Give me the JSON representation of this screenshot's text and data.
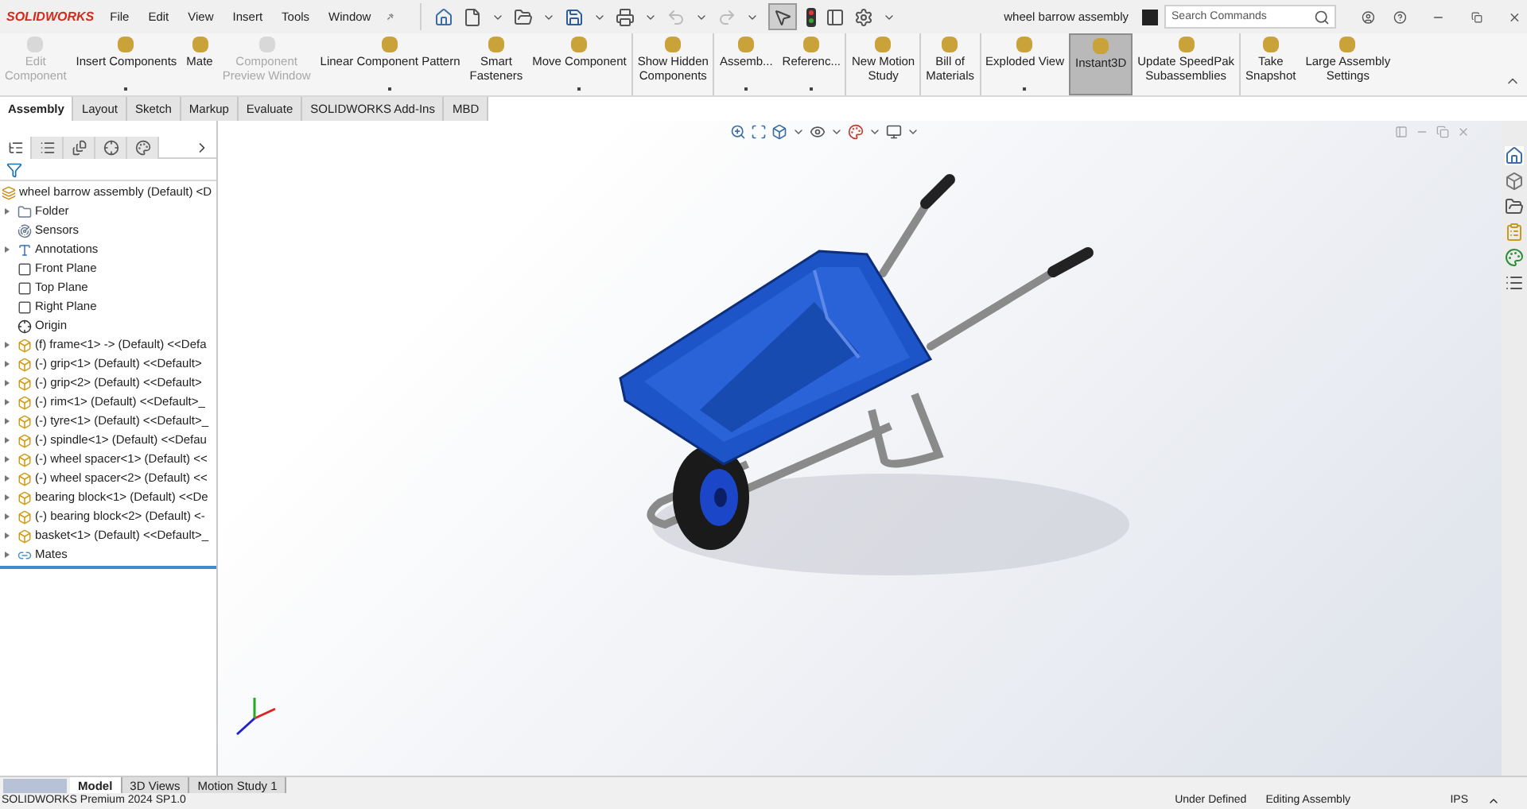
{
  "app": {
    "logo": "SOLIDWORKS",
    "title": "wheel barrow assembly"
  },
  "menu": [
    "File",
    "Edit",
    "View",
    "Insert",
    "Tools",
    "Window"
  ],
  "select_tool": {
    "selected": true
  },
  "search": {
    "placeholder": "Search Commands"
  },
  "commands": [
    {
      "label": "Edit\nComponent",
      "disabled": true,
      "selected": false,
      "dropdown": false,
      "divider_after": false
    },
    {
      "label": "Insert Components",
      "disabled": false,
      "selected": false,
      "dropdown": true,
      "divider_after": false
    },
    {
      "label": "Mate",
      "disabled": false,
      "selected": false,
      "dropdown": false,
      "divider_after": false
    },
    {
      "label": "Component\nPreview Window",
      "disabled": true,
      "selected": false,
      "dropdown": false,
      "divider_after": false
    },
    {
      "label": "Linear Component Pattern",
      "disabled": false,
      "selected": false,
      "dropdown": true,
      "divider_after": false
    },
    {
      "label": "Smart\nFasteners",
      "disabled": false,
      "selected": false,
      "dropdown": false,
      "divider_after": false
    },
    {
      "label": "Move Component",
      "disabled": false,
      "selected": false,
      "dropdown": true,
      "divider_after": true
    },
    {
      "label": "Show Hidden\nComponents",
      "disabled": false,
      "selected": false,
      "dropdown": false,
      "divider_after": true
    },
    {
      "label": "Assemb...",
      "disabled": false,
      "selected": false,
      "dropdown": true,
      "divider_after": false
    },
    {
      "label": "Referenc...",
      "disabled": false,
      "selected": false,
      "dropdown": true,
      "divider_after": true
    },
    {
      "label": "New Motion\nStudy",
      "disabled": false,
      "selected": false,
      "dropdown": false,
      "divider_after": true
    },
    {
      "label": "Bill of\nMaterials",
      "disabled": false,
      "selected": false,
      "dropdown": false,
      "divider_after": true
    },
    {
      "label": "Exploded View",
      "disabled": false,
      "selected": false,
      "dropdown": true,
      "divider_after": false
    },
    {
      "label": "Instant3D",
      "disabled": false,
      "selected": true,
      "dropdown": false,
      "divider_after": false
    },
    {
      "label": "Update SpeedPak\nSubassemblies",
      "disabled": false,
      "selected": false,
      "dropdown": false,
      "divider_after": true
    },
    {
      "label": "Take\nSnapshot",
      "disabled": false,
      "selected": false,
      "dropdown": false,
      "divider_after": false
    },
    {
      "label": "Large Assembly\nSettings",
      "disabled": false,
      "selected": false,
      "dropdown": false,
      "divider_after": false
    }
  ],
  "tabs": [
    {
      "label": "Assembly",
      "selected": true
    },
    {
      "label": "Layout",
      "selected": false
    },
    {
      "label": "Sketch",
      "selected": false
    },
    {
      "label": "Markup",
      "selected": false
    },
    {
      "label": "Evaluate",
      "selected": false
    },
    {
      "label": "SOLIDWORKS Add-Ins",
      "selected": false
    },
    {
      "label": "MBD",
      "selected": false
    }
  ],
  "manager_tabs": [
    {
      "kind": "tree",
      "selected": true
    },
    {
      "kind": "properties",
      "selected": false
    },
    {
      "kind": "config",
      "selected": false
    },
    {
      "kind": "dimxpert",
      "selected": false
    },
    {
      "kind": "display",
      "selected": false
    }
  ],
  "tree": {
    "label": "wheel barrow assembly (Default) <D",
    "kind": "assembly",
    "children": [
      {
        "label": "Folder",
        "kind": "folder",
        "has_children": true
      },
      {
        "label": "Sensors",
        "kind": "sensor",
        "has_children": false
      },
      {
        "label": "Annotations",
        "kind": "annotation",
        "has_children": true
      },
      {
        "label": "Front Plane",
        "kind": "plane",
        "has_children": false
      },
      {
        "label": "Top Plane",
        "kind": "plane",
        "has_children": false
      },
      {
        "label": "Right Plane",
        "kind": "plane",
        "has_children": false
      },
      {
        "label": "Origin",
        "kind": "origin",
        "has_children": false
      },
      {
        "label": "(f) frame<1> -> (Default) <<Defa",
        "kind": "part",
        "has_children": true
      },
      {
        "label": "(-) grip<1> (Default) <<Default>",
        "kind": "part",
        "has_children": true
      },
      {
        "label": "(-) grip<2> (Default) <<Default>",
        "kind": "part",
        "has_children": true
      },
      {
        "label": "(-) rim<1> (Default) <<Default>_",
        "kind": "part",
        "has_children": true
      },
      {
        "label": "(-) tyre<1> (Default) <<Default>_",
        "kind": "part",
        "has_children": true
      },
      {
        "label": "(-) spindle<1> (Default) <<Defau",
        "kind": "part",
        "has_children": true
      },
      {
        "label": "(-) wheel spacer<1> (Default) <<",
        "kind": "part",
        "has_children": true
      },
      {
        "label": "(-) wheel spacer<2> (Default) <<",
        "kind": "part",
        "has_children": true
      },
      {
        "label": "bearing block<1> (Default) <<De",
        "kind": "part",
        "has_children": true
      },
      {
        "label": "(-) bearing block<2> (Default) <-",
        "kind": "part",
        "has_children": true
      },
      {
        "label": "basket<1> (Default) <<Default>_",
        "kind": "part",
        "has_children": true
      },
      {
        "label": "Mates",
        "kind": "mates",
        "has_children": true
      }
    ]
  },
  "bottom_tabs": [
    {
      "label": "Model",
      "selected": true
    },
    {
      "label": "3D Views",
      "selected": false
    },
    {
      "label": "Motion Study 1",
      "selected": false
    }
  ],
  "status_bar": {
    "product": "SOLIDWORKS Premium 2024 SP1.0",
    "state": "Under Defined",
    "mode": "Editing Assembly",
    "units": "IPS"
  }
}
